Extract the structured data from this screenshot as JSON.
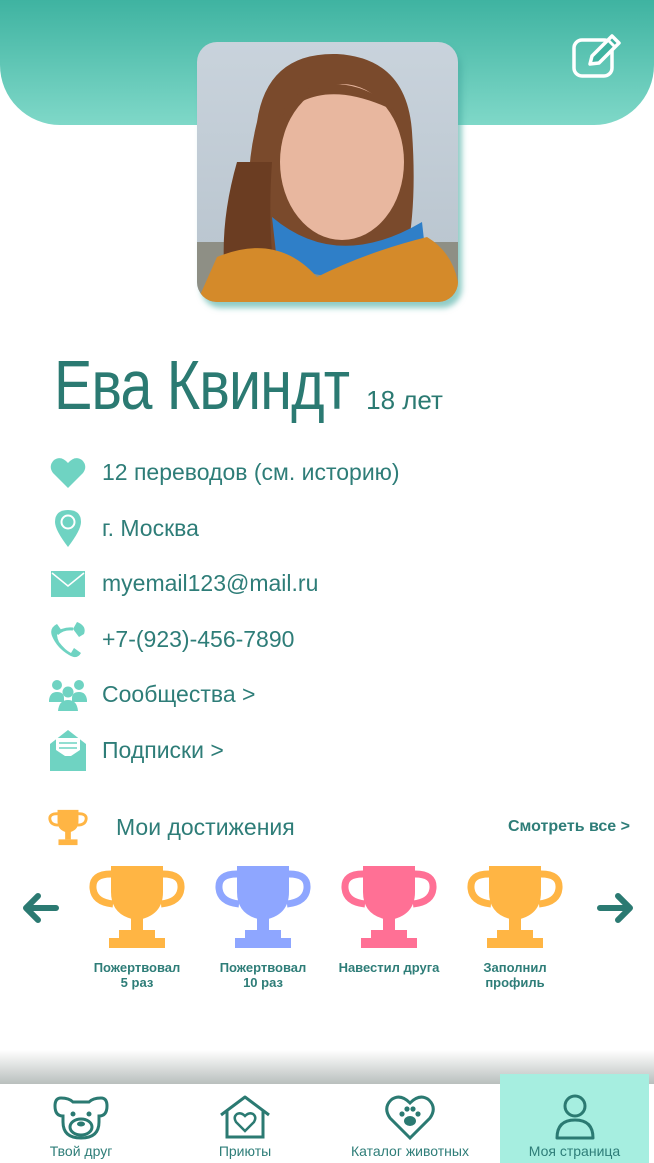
{
  "profile": {
    "name": "Ева Квиндт",
    "age": "18 лет"
  },
  "info": {
    "transfers": "12 переводов (см. историю)",
    "city": "г. Москва",
    "email": "myemail123@mail.ru",
    "phone": "+7-(923)-456-7890",
    "communities": "Сообщества >",
    "subscriptions": "Подписки >"
  },
  "achievements": {
    "title": "Мои достижения",
    "see_all": "Смотреть все >",
    "items": [
      {
        "label": "Пожертвовал\n5 раз",
        "color": "#ffb544"
      },
      {
        "label": "Пожертвовал\n10 раз",
        "color": "#8ea6ff"
      },
      {
        "label": "Навестил друга",
        "color": "#ff7095"
      },
      {
        "label": "Заполнил\nпрофиль",
        "color": "#ffb544"
      }
    ]
  },
  "tabs": [
    {
      "label": "Твой друг",
      "icon": "dog-icon"
    },
    {
      "label": "Приюты",
      "icon": "house-heart-icon"
    },
    {
      "label": "Каталог животных",
      "icon": "paw-heart-icon"
    },
    {
      "label": "Моя страница",
      "icon": "user-icon",
      "active": true
    }
  ],
  "colors": {
    "accent": "#3fb3a1",
    "text": "#2e7d78",
    "icon": "#6fd3c2",
    "active_tab": "#a6eee0"
  }
}
